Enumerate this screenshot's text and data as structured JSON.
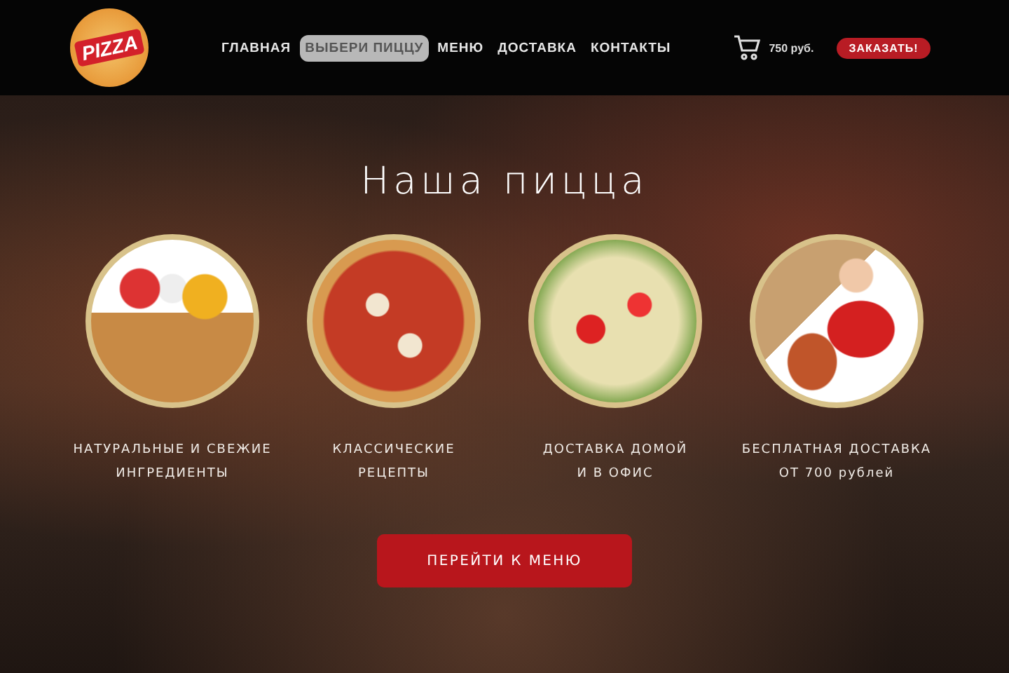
{
  "logo": {
    "text": "PIZZA"
  },
  "nav": [
    {
      "label": "ГЛАВНАЯ",
      "selected": false
    },
    {
      "label": "ВЫБЕРИ ПИЦЦУ",
      "selected": true
    },
    {
      "label": "МЕНЮ",
      "selected": false
    },
    {
      "label": "ДОСТАВКА",
      "selected": false
    },
    {
      "label": "КОНТАКТЫ",
      "selected": false
    }
  ],
  "cart": {
    "total": "750 руб."
  },
  "order_button": "ЗАКАЗАТЬ!",
  "hero": {
    "title": "Наша пицца",
    "features": [
      {
        "caption": "НАТУРАЛЬНЫЕ И СВЕЖИЕ\nИНГРЕДИЕНТЫ"
      },
      {
        "caption": "КЛАССИЧЕСКИЕ\nРЕЦЕПТЫ"
      },
      {
        "caption": "ДОСТАВКА ДОМОЙ\nИ В ОФИС"
      },
      {
        "caption": "БЕСПЛАТНАЯ ДОСТАВКА\nОТ 700 рублей"
      }
    ],
    "button": "ПЕРЕЙТИ К МЕНЮ"
  }
}
